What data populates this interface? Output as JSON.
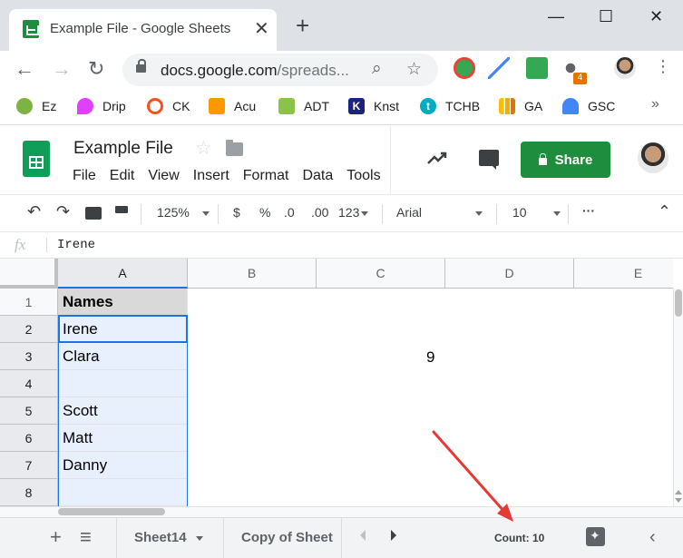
{
  "browser": {
    "tab_title": "Example File - Google Sheets",
    "tab_close": "✕",
    "new_tab": "+",
    "window_controls": {
      "minimize": "—",
      "maximize": "☐",
      "close": "✕"
    },
    "url_host": "docs.google.com",
    "url_path": "/spreads...",
    "extension_badge": "4",
    "bookmarks": [
      "Ez",
      "Drip",
      "CK",
      "Acu",
      "ADT",
      "Knst",
      "TCHB",
      "GA",
      "GSC"
    ],
    "bookmarks_more": "»"
  },
  "sheets": {
    "doc_title": "Example File",
    "menu": [
      "File",
      "Edit",
      "View",
      "Insert",
      "Format",
      "Data",
      "Tools"
    ],
    "share_label": "Share"
  },
  "format_toolbar": {
    "zoom": "125%",
    "currency": "$",
    "percent": "%",
    "decimal_decrease": ".0",
    "decimal_increase": ".00",
    "number_format": "123",
    "font": "Arial",
    "font_size": "10",
    "more": "···"
  },
  "formula_bar": {
    "fx": "fx",
    "value": "Irene"
  },
  "grid": {
    "columns": [
      "A",
      "B",
      "C",
      "D",
      "E"
    ],
    "rows": [
      "1",
      "2",
      "3",
      "4",
      "5",
      "6",
      "7",
      "8"
    ],
    "column_a": [
      "Names",
      "Irene",
      "Clara",
      "",
      "Scott",
      "Matt",
      "Danny",
      ""
    ],
    "c3_value": "9"
  },
  "bottom_bar": {
    "add_sheet": "+",
    "all_sheets": "≡",
    "sheet_tabs": [
      "Sheet14",
      "Copy of Sheet"
    ],
    "count_label": "Count: 10"
  },
  "colors": {
    "accent": "#1a73e8",
    "share_green": "#1e8e3e",
    "annotation": "#e53935"
  }
}
